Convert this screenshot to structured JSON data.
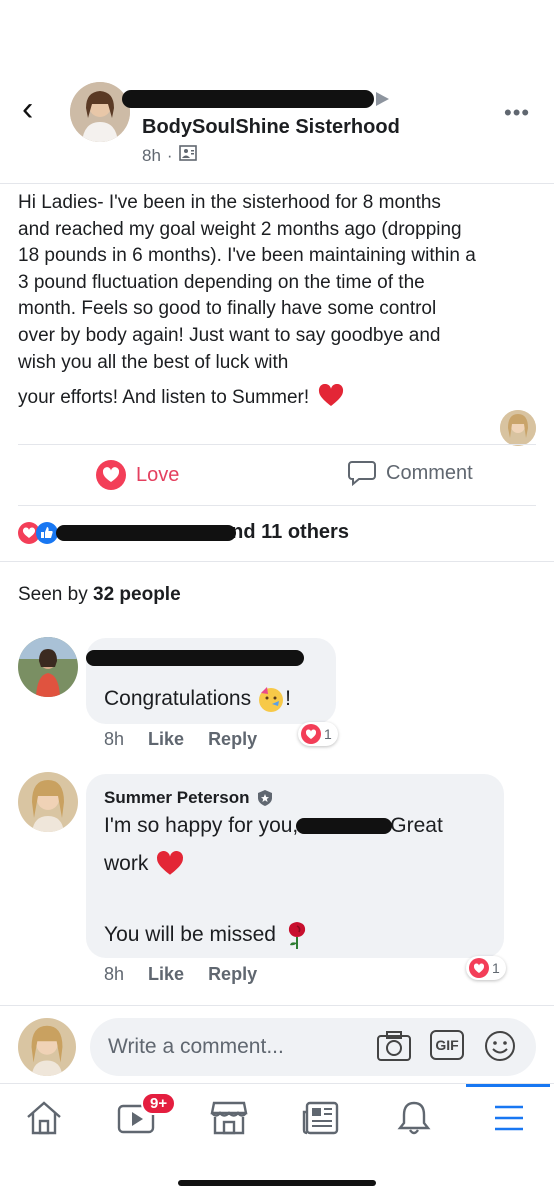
{
  "post": {
    "group_name": "BodySoulShine Sisterhood",
    "time": "8h",
    "body_lines": [
      "Hi Ladies-  I've been in the sisterhood for 8 months",
      "and reached my goal weight 2 months ago (dropping",
      "18 pounds in 6 months). I've been maintaining within a",
      "3 pound fluctuation depending on the time of the",
      "month.  Feels so good to finally have some control",
      "over by body again! Just want to say goodbye and",
      "wish you all the best of luck with"
    ],
    "body_last": "your efforts! And listen to Summer!"
  },
  "actions": {
    "love_label": "Love",
    "comment_label": "Comment"
  },
  "reactions": {
    "others_text": "and 11 others"
  },
  "seen": {
    "prefix": "Seen by ",
    "count_text": "32 people"
  },
  "comments": [
    {
      "text": "Congratulations",
      "suffix": "!",
      "time": "8h",
      "like_label": "Like",
      "reply_label": "Reply",
      "reaction_count": "1"
    },
    {
      "author": "Summer Peterson",
      "line1": "I'm so happy for you,",
      "line1_end": "Great",
      "line2": "work",
      "line3": "You will be missed",
      "time": "8h",
      "like_label": "Like",
      "reply_label": "Reply",
      "reaction_count": "1"
    }
  ],
  "composer": {
    "placeholder": "Write a comment...",
    "gif_label": "GIF"
  },
  "nav": {
    "watch_badge": "9+",
    "items": [
      "home-icon",
      "watch-icon",
      "marketplace-icon",
      "news-icon",
      "notifications-icon",
      "menu-icon"
    ]
  },
  "colors": {
    "love": "#e4405f",
    "accent": "#1877f2",
    "badge": "#e41e3f",
    "heart": "#f33e58"
  }
}
